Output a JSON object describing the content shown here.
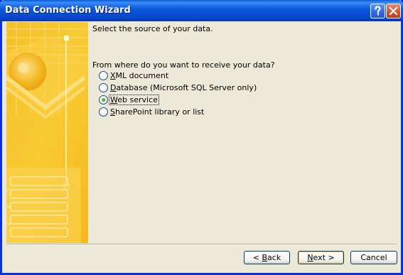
{
  "window": {
    "title": "Data Connection Wizard"
  },
  "titlebar_buttons": {
    "help_icon": "question-mark",
    "close_icon": "x"
  },
  "instructions": "Select the source of your data.",
  "question": "From where do you want to receive your data?",
  "options": [
    {
      "mnemonic": "X",
      "rest": "ML document",
      "checked": false
    },
    {
      "mnemonic": "D",
      "rest": "atabase (Microsoft SQL Server only)",
      "checked": false
    },
    {
      "mnemonic": "W",
      "rest": "eb service",
      "checked": true
    },
    {
      "mnemonic": "S",
      "rest": "harePoint library or list",
      "checked": false
    }
  ],
  "buttons": {
    "back": {
      "prefix": "< ",
      "mnemonic": "B",
      "rest": "ack"
    },
    "next": {
      "prefix": "",
      "mnemonic": "N",
      "rest": "ext >"
    },
    "cancel": {
      "label": "Cancel"
    }
  },
  "colors": {
    "titlebar": "#0A5FD8",
    "dialog_bg": "#ECE9D8",
    "side_panel": "#F7C325",
    "radio_checked": "#21A121"
  }
}
